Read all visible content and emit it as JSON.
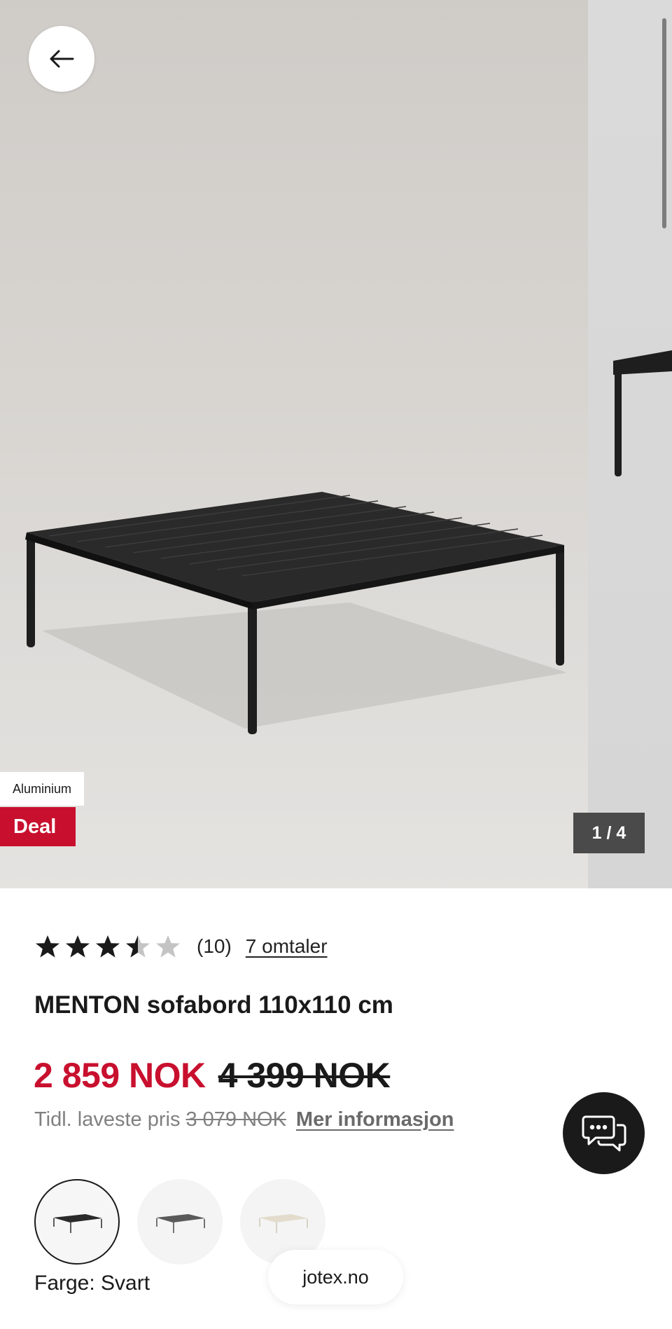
{
  "gallery": {
    "material_tag": "Aluminium",
    "deal_tag": "Deal",
    "counter": "1 / 4"
  },
  "product": {
    "rating": 3.5,
    "rating_max": 5,
    "rating_count": "(10)",
    "reviews_link": "7 omtaler",
    "title": "MENTON sofabord 110x110 cm",
    "price_now": "2 859 NOK",
    "price_old": "4 399 NOK",
    "lowest_label": "Tidl. laveste pris",
    "lowest_price": "3 079 NOK",
    "more_info": "Mer informasjon"
  },
  "variants": {
    "swatches": [
      "Svart",
      "Grå",
      "Beige"
    ],
    "color_label": "Farge: Svart"
  },
  "browser": {
    "domain": "jotex.no"
  },
  "colors": {
    "accent_red": "#c8102e",
    "text": "#1a1a1a",
    "muted": "#808080",
    "star_filled": "#1a1a1a",
    "star_empty": "#c4c4c4"
  },
  "icons": {
    "back": "arrow-left-icon",
    "chat": "chat-bubbles-icon",
    "star": "star-icon"
  }
}
